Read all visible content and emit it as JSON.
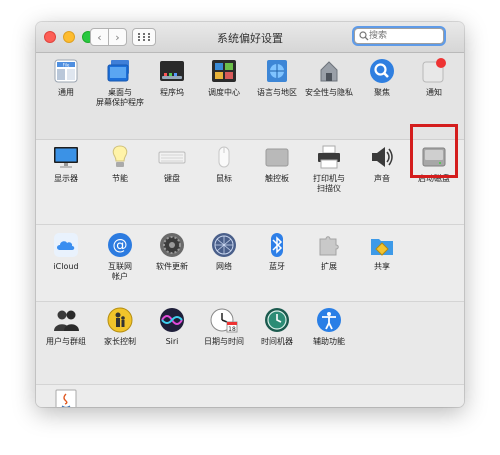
{
  "window": {
    "title": "系统偏好设置"
  },
  "search": {
    "placeholder": "搜索"
  },
  "colors": {
    "highlight": "#d41d1d",
    "search_focus": "#5f9be8"
  },
  "sections": [
    [
      {
        "label": "通用",
        "icon": "general-icon"
      },
      {
        "label": "桌面与\n屏幕保护程序",
        "icon": "desktop-screensaver-icon"
      },
      {
        "label": "程序坞",
        "icon": "dock-icon"
      },
      {
        "label": "调度中心",
        "icon": "mission-control-icon"
      },
      {
        "label": "语言与地区",
        "icon": "language-region-icon"
      },
      {
        "label": "安全性与隐私",
        "icon": "security-privacy-icon"
      },
      {
        "label": "聚焦",
        "icon": "spotlight-icon"
      },
      {
        "label": "通知",
        "icon": "notifications-icon"
      }
    ],
    [
      {
        "label": "显示器",
        "icon": "displays-icon"
      },
      {
        "label": "节能",
        "icon": "energy-saver-icon"
      },
      {
        "label": "键盘",
        "icon": "keyboard-icon"
      },
      {
        "label": "鼠标",
        "icon": "mouse-icon"
      },
      {
        "label": "触控板",
        "icon": "trackpad-icon"
      },
      {
        "label": "打印机与\n扫描仪",
        "icon": "printers-scanners-icon"
      },
      {
        "label": "声音",
        "icon": "sound-icon"
      },
      {
        "label": "启动磁盘",
        "icon": "startup-disk-icon"
      }
    ],
    [
      {
        "label": "iCloud",
        "icon": "icloud-icon"
      },
      {
        "label": "互联网\n帐户",
        "icon": "internet-accounts-icon"
      },
      {
        "label": "软件更新",
        "icon": "software-update-icon"
      },
      {
        "label": "网络",
        "icon": "network-icon"
      },
      {
        "label": "蓝牙",
        "icon": "bluetooth-icon"
      },
      {
        "label": "扩展",
        "icon": "extensions-icon"
      },
      {
        "label": "共享",
        "icon": "sharing-icon"
      }
    ],
    [
      {
        "label": "用户与群组",
        "icon": "users-groups-icon"
      },
      {
        "label": "家长控制",
        "icon": "parental-controls-icon"
      },
      {
        "label": "Siri",
        "icon": "siri-icon"
      },
      {
        "label": "日期与时间",
        "icon": "date-time-icon"
      },
      {
        "label": "时间机器",
        "icon": "time-machine-icon"
      },
      {
        "label": "辅助功能",
        "icon": "accessibility-icon"
      }
    ],
    [
      {
        "label": "Java",
        "icon": "java-icon"
      }
    ]
  ]
}
